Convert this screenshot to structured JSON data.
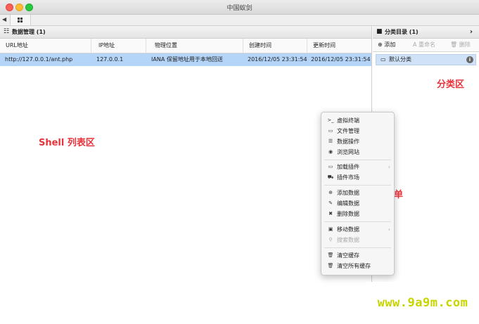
{
  "window": {
    "title": "中国蚁剑"
  },
  "tabs": {
    "prev_arrow": "◀",
    "home_icon": "grid-icon"
  },
  "data_panel": {
    "title": "数据管理 (1)",
    "icon": "list-icon",
    "columns": [
      "URL地址",
      "IP地址",
      "物理位置",
      "创建时间",
      "更新时间"
    ],
    "rows": [
      {
        "url": "http://127.0.0.1/ant.php",
        "ip": "127.0.0.1",
        "location": "IANA 保留地址用于本地回送",
        "created": "2016/12/05 23:31:54",
        "updated": "2016/12/05 23:31:54"
      }
    ]
  },
  "category_panel": {
    "title": "分类目录 (1)",
    "icon": "folder-icon",
    "chevron": "›",
    "toolbar": {
      "add": "添加",
      "rename": "重命名",
      "delete": "删除"
    },
    "items": [
      {
        "label": "默认分类",
        "count_icon": "i"
      }
    ]
  },
  "context_menu": {
    "items": [
      {
        "label": "虚拟终端",
        "icon": "terminal-icon",
        "glyph": ">_"
      },
      {
        "label": "文件管理",
        "icon": "folder-icon",
        "glyph": "▭"
      },
      {
        "label": "数据操作",
        "icon": "database-icon",
        "glyph": "☰"
      },
      {
        "label": "浏览网站",
        "icon": "chrome-icon",
        "glyph": "◉"
      },
      {
        "label": "加载插件",
        "icon": "folder-icon",
        "glyph": "▭",
        "submenu": true
      },
      {
        "label": "插件市场",
        "icon": "cart-icon",
        "glyph": "⛟"
      },
      {
        "label": "添加数据",
        "icon": "plus-circle-icon",
        "glyph": "⊕"
      },
      {
        "label": "编辑数据",
        "icon": "edit-icon",
        "glyph": "✎"
      },
      {
        "label": "删除数据",
        "icon": "close-icon",
        "glyph": "✖"
      },
      {
        "label": "移动数据",
        "icon": "image-icon",
        "glyph": "▣",
        "submenu": true
      },
      {
        "label": "搜索数据",
        "icon": "search-icon",
        "glyph": "⚲",
        "disabled": true
      },
      {
        "label": "清空缓存",
        "icon": "trash-icon",
        "glyph": "🗑"
      },
      {
        "label": "清空所有缓存",
        "icon": "trash-icon",
        "glyph": "🗑"
      }
    ]
  },
  "annotations": {
    "shell_list": "Shell 列表区",
    "category_area": "分类区",
    "popup_menu": "弹出菜单"
  },
  "watermark": "www.9a9m.com",
  "colors": {
    "selected_row": "#b4d4f8",
    "annotation": "#e8333a",
    "watermark": "#c8d400"
  }
}
